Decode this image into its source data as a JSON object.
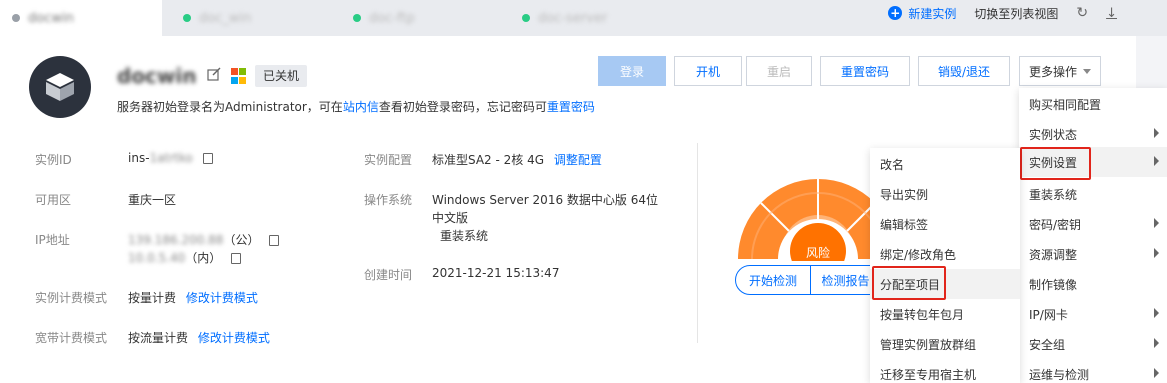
{
  "tabs": [
    {
      "label": "docwin",
      "active": true
    },
    {
      "label": "doc_win",
      "active": false
    },
    {
      "label": "doc-ftp",
      "active": false
    },
    {
      "label": "doc-server",
      "active": false
    }
  ],
  "tab_actions": {
    "new_instance": "新建实例",
    "switch_view": "切换至列表视图"
  },
  "instance": {
    "name": "docwin",
    "status": "已关机",
    "notice_prefix": "服务器初始登录名为Administrator，可在",
    "notice_link1": "站内信",
    "notice_middle": "查看初始登录密码，忘记密码可",
    "notice_link2": "重置密码"
  },
  "actions": {
    "login": "登录",
    "start": "开机",
    "restart": "重启",
    "reset_password": "重置密码",
    "destroy": "销毁/退还",
    "more": "更多操作"
  },
  "info": {
    "id_label": "实例ID",
    "id_prefix": "ins-",
    "id_hidden": "1atrtko",
    "zone_label": "可用区",
    "zone_value": "重庆一区",
    "ip_label": "IP地址",
    "ip_public": "139.186.200.88",
    "ip_public_tag": "（公）",
    "ip_private": "10.0.5.40",
    "ip_private_tag": "（内）",
    "billing_label": "实例计费模式",
    "billing_value": "按量计费",
    "billing_link": "修改计费模式",
    "bandwidth_label": "宽带计费模式",
    "bandwidth_value": "按流量计费",
    "bandwidth_link": "修改计费模式",
    "config_label": "实例配置",
    "config_value": "标准型SA2 - 2核 4G",
    "config_link": "调整配置",
    "os_label": "操作系统",
    "os_value_line1": "Windows Server 2016 数据中心版 64位",
    "os_value_line2": "中文版",
    "os_link": "重装系统",
    "created_label": "创建时间",
    "created_value": "2021-12-21 15:13:47"
  },
  "gauge": {
    "label": "风险",
    "start_check": "开始检测",
    "check_report": "检测报告"
  },
  "more_menu": [
    {
      "label": "购买相同配置",
      "sub": false
    },
    {
      "label": "实例状态",
      "sub": true
    },
    {
      "label": "实例设置",
      "sub": true,
      "highlight": true
    },
    {
      "label": "重装系统",
      "sub": false
    },
    {
      "label": "密码/密钥",
      "sub": true
    },
    {
      "label": "资源调整",
      "sub": true
    },
    {
      "label": "制作镜像",
      "sub": false
    },
    {
      "label": "IP/网卡",
      "sub": true
    },
    {
      "label": "安全组",
      "sub": true
    },
    {
      "label": "运维与检测",
      "sub": true
    }
  ],
  "settings_submenu": [
    {
      "label": "改名"
    },
    {
      "label": "导出实例"
    },
    {
      "label": "编辑标签"
    },
    {
      "label": "绑定/修改角色"
    },
    {
      "label": "分配至项目",
      "highlight": true
    },
    {
      "label": "按量转包年包月"
    },
    {
      "label": "管理实例置放群组"
    },
    {
      "label": "迁移至专用宿主机"
    }
  ],
  "colors": {
    "accent": "#006eff",
    "gauge_orange": "#ff7200",
    "gauge_light": "#ffb27a",
    "highlight_red": "#e1251b"
  }
}
